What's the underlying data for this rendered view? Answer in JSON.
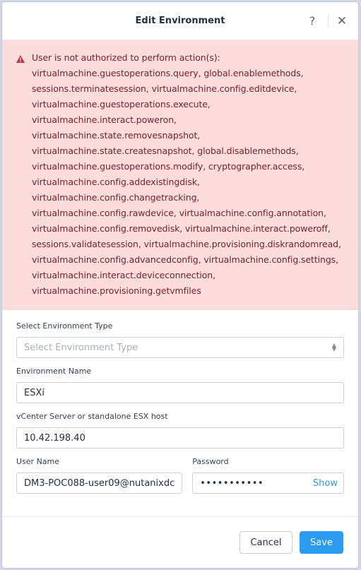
{
  "dialog": {
    "title": "Edit Environment",
    "help_label": "?",
    "close_label": "✕"
  },
  "error": {
    "icon": "warning-icon",
    "lines": [
      "User is not authorized to perform action(s):",
      "virtualmachine.guestoperations.query, global.enablemethods,",
      "sessions.terminatesession, virtualmachine.config.editdevice,",
      "virtualmachine.guestoperations.execute,",
      "virtualmachine.interact.poweron,",
      "virtualmachine.state.removesnapshot,",
      "virtualmachine.state.createsnapshot, global.disablemethods,",
      "virtualmachine.guestoperations.modify, cryptographer.access,",
      "virtualmachine.config.addexistingdisk,",
      "virtualmachine.config.changetracking,",
      "virtualmachine.config.rawdevice, virtualmachine.config.annotation,",
      "virtualmachine.config.removedisk, virtualmachine.interact.poweroff,",
      "sessions.validatesession, virtualmachine.provisioning.diskrandomread,",
      "virtualmachine.config.advancedconfig, virtualmachine.config.settings,",
      "virtualmachine.interact.deviceconnection,",
      "virtualmachine.provisioning.getvmfiles"
    ],
    "color": "#7a2033",
    "background": "#fcdcdc"
  },
  "form": {
    "env_type": {
      "label": "Select Environment Type",
      "placeholder": "Select Environment Type"
    },
    "env_name": {
      "label": "Environment Name",
      "value": "ESXi"
    },
    "vcenter": {
      "label": "vCenter Server or standalone ESX host",
      "value": "10.42.198.40"
    },
    "username": {
      "label": "User Name",
      "value": "DM3-POC088-user09@nutanixdc"
    },
    "password": {
      "label": "Password",
      "value": "•••••••••••",
      "show_label": "Show"
    }
  },
  "footer": {
    "cancel_label": "Cancel",
    "save_label": "Save"
  },
  "colors": {
    "accent": "#2b9cf0",
    "error_text": "#7a2033"
  }
}
